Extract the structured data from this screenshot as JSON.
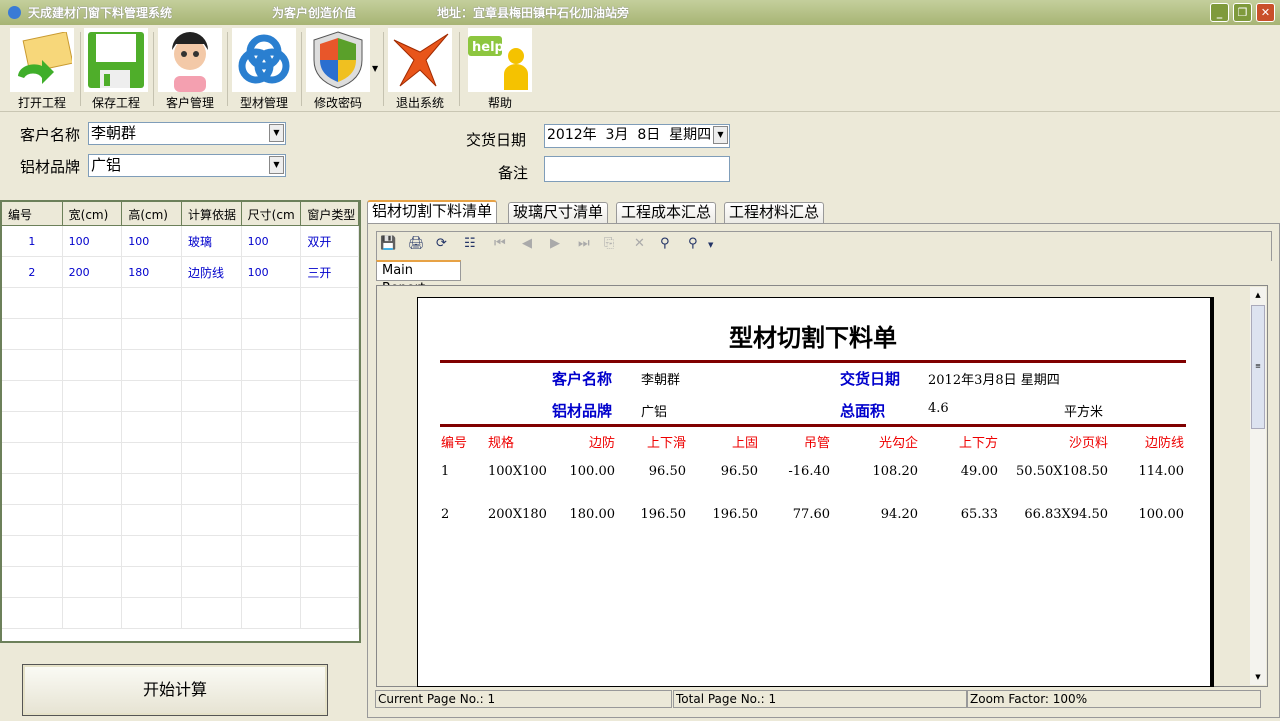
{
  "window": {
    "title": "天成建材门窗下料管理系统",
    "slogan": "为客户创造价值",
    "address": "地址：宜章县梅田镇中石化加油站旁",
    "controls": [
      "minimize",
      "restore",
      "close"
    ]
  },
  "toolbar": [
    {
      "label": "打开工程",
      "icon": "open-envelope-icon"
    },
    {
      "label": "保存工程",
      "icon": "floppy-save-icon"
    },
    {
      "label": "客户管理",
      "icon": "girl-avatar-icon"
    },
    {
      "label": "型材管理",
      "icon": "blue-knot-icon"
    },
    {
      "label": "修改密码",
      "icon": "shield-icon"
    },
    {
      "label": "退出系统",
      "icon": "red-x-icon"
    },
    {
      "label": "帮助",
      "icon": "help-person-icon"
    }
  ],
  "form": {
    "customer_label": "客户名称",
    "customer_value": "李朝群",
    "brand_label": "铝材品牌",
    "brand_value": "广铝",
    "date_label": "交货日期",
    "date_value": "2012年  3月  8日  星期四",
    "note_label": "备注",
    "note_value": ""
  },
  "grid": {
    "headers": [
      "编号",
      "宽(cm)",
      "高(cm)",
      "计算依据",
      "尺寸(cm",
      "窗户类型"
    ],
    "rows": [
      [
        "1",
        "100",
        "100",
        "玻璃",
        "100",
        "双开"
      ],
      [
        "2",
        "200",
        "180",
        "边防线",
        "100",
        "三开"
      ]
    ]
  },
  "calc_button": "开始计算",
  "tabs": [
    "铝材切割下料清单",
    "玻璃尺寸清单",
    "工程成本汇总",
    "工程材料汇总"
  ],
  "viewer": {
    "main_tab": "Main Report",
    "tools": [
      "export-icon",
      "print-icon",
      "refresh-icon",
      "tree-icon",
      "first-page-icon",
      "prev-page-icon",
      "next-page-icon",
      "last-page-icon",
      "goto-page-icon",
      "stop-icon",
      "search-icon",
      "zoom-icon"
    ],
    "status": {
      "current": "Current Page No.: 1",
      "total": "Total Page No.: 1",
      "zoom": "Zoom Factor: 100%"
    }
  },
  "report": {
    "title": "型材切割下料单",
    "customer_label": "客户名称",
    "customer": "李朝群",
    "date_label": "交货日期",
    "date": "2012年3月8日 星期四",
    "brand_label": "铝材品牌",
    "brand": "广铝",
    "area_label": "总面积",
    "area": "4.6",
    "area_unit": "平方米",
    "headers": [
      "编号",
      "规格",
      "边防",
      "上下滑",
      "上固",
      "吊管",
      "光勾企",
      "上下方",
      "沙页料",
      "边防线"
    ],
    "rows": [
      [
        "1",
        "100X100",
        "100.00",
        "96.50",
        "96.50",
        "-16.40",
        "108.20",
        "49.00",
        "50.50X108.50",
        "114.00"
      ],
      [
        "2",
        "200X180",
        "180.00",
        "196.50",
        "196.50",
        "77.60",
        "94.20",
        "65.33",
        "66.83X94.50",
        "100.00"
      ]
    ]
  },
  "colors": {
    "titlebar": "#a7b474",
    "report_rule": "#800000",
    "label_blue": "#0000cc",
    "header_red": "#ee0000"
  }
}
